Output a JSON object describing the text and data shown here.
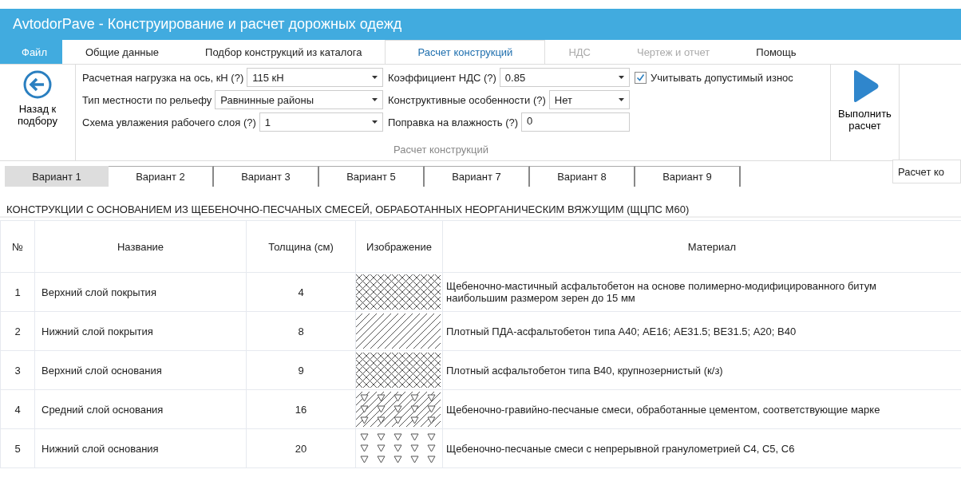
{
  "window": {
    "title": "AvtodorPave - Конструирование и расчет дорожных одежд"
  },
  "menu_tabs": [
    {
      "label": "Файл",
      "kind": "file",
      "selected": false,
      "disabled": false
    },
    {
      "label": "Общие данные",
      "kind": "tab",
      "selected": false,
      "disabled": false
    },
    {
      "label": "Подбор конструкций из каталога",
      "kind": "tab",
      "selected": false,
      "disabled": false
    },
    {
      "label": "Расчет конструкций",
      "kind": "tab",
      "selected": true,
      "disabled": false
    },
    {
      "label": "НДС",
      "kind": "tab",
      "selected": false,
      "disabled": true
    },
    {
      "label": "Чертеж и отчет",
      "kind": "tab",
      "selected": false,
      "disabled": true
    },
    {
      "label": "Помощь",
      "kind": "tab",
      "selected": false,
      "disabled": false
    }
  ],
  "ribbon": {
    "back_button": {
      "label": "Назад к подбору"
    },
    "field_columns": [
      [
        {
          "label": "Расчетная нагрузка на ось, кН (?)",
          "value": "115 кН",
          "kind": "dropdown"
        },
        {
          "label": "Тип местности по рельефу",
          "value": "Равнинные районы",
          "kind": "dropdown"
        },
        {
          "label": "Схема увлажения рабочего слоя (?)",
          "value": "1",
          "kind": "dropdown"
        }
      ],
      [
        {
          "label": "Коэффициент НДС (?)",
          "value": "0.85",
          "kind": "dropdown"
        },
        {
          "label": "Конструктивные особенности (?)",
          "value": "Нет",
          "kind": "dropdown"
        },
        {
          "label": "Поправка на влажность (?)",
          "value": "0",
          "kind": "text"
        }
      ]
    ],
    "checkbox": {
      "label": "Учитывать допустимый износ",
      "checked": true
    },
    "group_label": "Расчет конструкций",
    "run_button": {
      "label": "Выполнить расчет"
    }
  },
  "side_panel": {
    "label": "Расчет ко"
  },
  "variant_tabs": [
    {
      "label": "Вариант 1",
      "selected": true
    },
    {
      "label": "Вариант 2",
      "selected": false
    },
    {
      "label": "Вариант 3",
      "selected": false
    },
    {
      "label": "Вариант 5",
      "selected": false
    },
    {
      "label": "Вариант 7",
      "selected": false
    },
    {
      "label": "Вариант 8",
      "selected": false
    },
    {
      "label": "Вариант 9",
      "selected": false
    }
  ],
  "heading": "КОНСТРУКЦИИ С ОСНОВАНИЕМ ИЗ ЩЕБЕНОЧНО-ПЕСЧАНЫХ СМЕСЕЙ,  ОБРАБОТАННЫХ НЕОРГАНИЧЕСКИМ ВЯЖУЩИМ (ЩЦПС М60)",
  "table": {
    "columns": [
      "№",
      "Название",
      "Толщина (см)",
      "Изображение",
      "Материал"
    ],
    "rows": [
      {
        "number": "1",
        "name": "Верхний слой покрытия",
        "thickness": "4",
        "kind": "crosshatch",
        "material": "Щебеночно-мастичный асфальтобетон на основе полимерно-модифицированного битум\nнаибольшим размером зерен до 15 мм"
      },
      {
        "number": "2",
        "name": "Нижний слой покрытия",
        "thickness": "8",
        "kind": "diagonal",
        "material": "Плотный ПДА-асфальтобетон типа А40; АЕ16; АЕ31.5; ВЕ31.5; А20; В40"
      },
      {
        "number": "3",
        "name": "Верхний слой основания",
        "thickness": "9",
        "kind": "crosshatch",
        "material": "Плотный асфальтобетон типа В40, крупнозернистый (к/з)"
      },
      {
        "number": "4",
        "name": "Средний слой основания",
        "thickness": "16",
        "kind": "diagonal-triangles",
        "material": "Щебеночно-гравийно-песчаные смеси, обработанные цементом, соответствующие марке"
      },
      {
        "number": "5",
        "name": "Нижний слой основания",
        "thickness": "20",
        "kind": "triangles",
        "material": "Щебеночно-песчаные смеси с непрерывной гранулометрией С4, С5, С6"
      }
    ]
  }
}
